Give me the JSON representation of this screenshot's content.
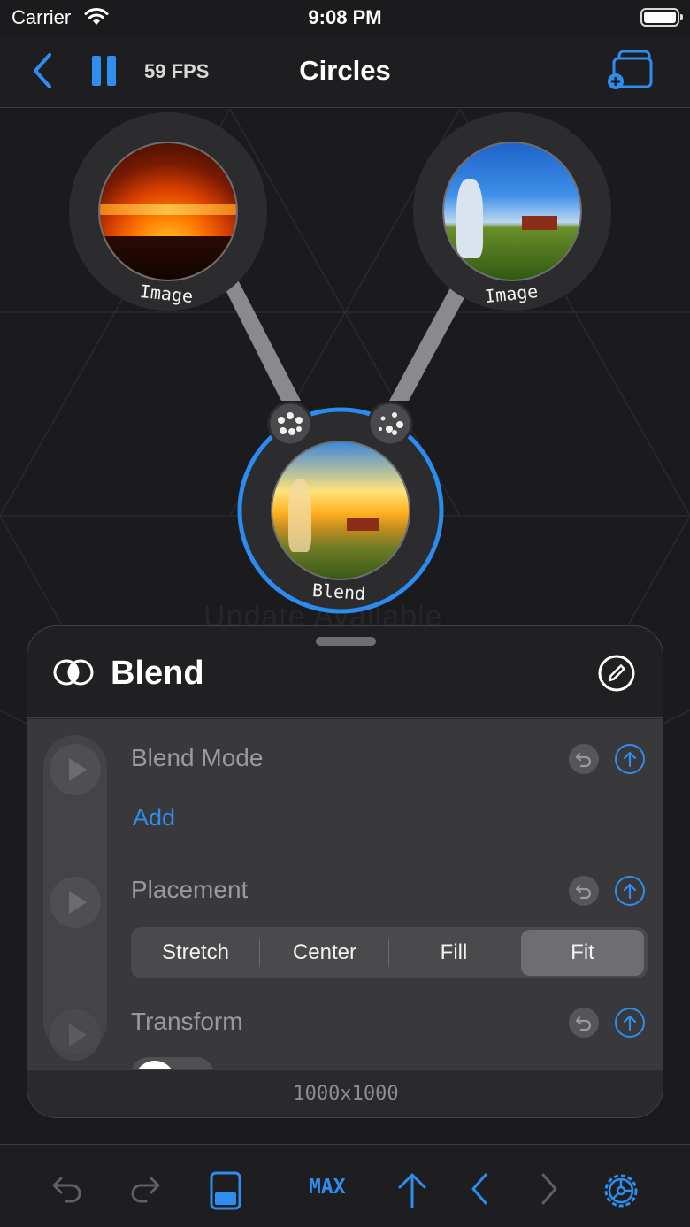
{
  "status_bar": {
    "carrier": "Carrier",
    "time": "9:08 PM"
  },
  "nav": {
    "title": "Circles",
    "fps": "59 FPS"
  },
  "canvas": {
    "watermark": "Update Available",
    "nodes": [
      {
        "label": "Image",
        "icon": "sunset-photo"
      },
      {
        "label": "Image",
        "icon": "kite-field-photo"
      },
      {
        "label": "Blend",
        "icon": "blended-photo",
        "selected": true
      }
    ]
  },
  "sheet": {
    "title": "Blend",
    "sections": [
      {
        "label": "Blend Mode",
        "action": "Add"
      },
      {
        "label": "Placement"
      },
      {
        "label": "Transform"
      }
    ],
    "placement_options": [
      "Stretch",
      "Center",
      "Fill",
      "Fit"
    ],
    "placement_selected": "Fit",
    "resolution": "1000x1000"
  },
  "toolbar": {
    "max_label": "MAX"
  },
  "colors": {
    "accent": "#2d8ef0",
    "background": "#1b1b1d",
    "sheet": "#2a2a2c"
  }
}
